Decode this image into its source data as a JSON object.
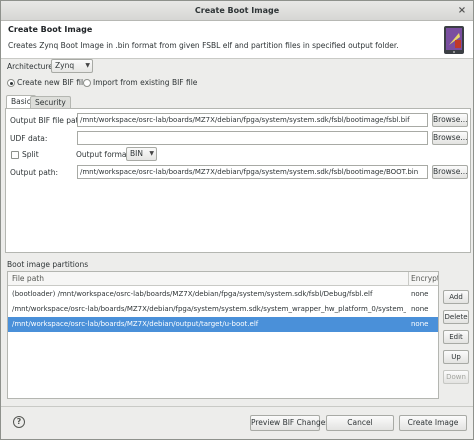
{
  "window": {
    "title": "Create Boot Image",
    "close_glyph": "×"
  },
  "banner": {
    "title": "Create Boot Image",
    "description": "Creates Zynq Boot Image in .bin format from given FSBL elf and partition files in specified output folder.",
    "icon": "boot-image-icon"
  },
  "architecture": {
    "label": "Architecture:",
    "value": "Zynq"
  },
  "mode": {
    "create_new_label": "Create new BIF file",
    "import_label": "Import from existing BIF file",
    "selected": "create_new"
  },
  "tabs": [
    {
      "label": "Basic",
      "active": true
    },
    {
      "label": "Security",
      "active": false
    }
  ],
  "basic": {
    "output_bif_label": "Output BIF file path:",
    "output_bif_value": "/mnt/workspace/osrc-lab/boards/MZ7X/debian/fpga/system/system.sdk/fsbl/bootimage/fsbl.bif",
    "udf_label": "UDF data:",
    "udf_value": "",
    "split_label": "Split",
    "split_checked": false,
    "output_format_label": "Output format:",
    "output_format_value": "BIN",
    "output_path_label": "Output path:",
    "output_path_value": "/mnt/workspace/osrc-lab/boards/MZ7X/debian/fpga/system/system.sdk/fsbl/bootimage/BOOT.bin",
    "browse_label": "Browse..."
  },
  "partitions": {
    "section_title": "Boot image partitions",
    "columns": [
      "File path",
      "Encrypted"
    ],
    "rows": [
      {
        "file_path": "(bootloader) /mnt/workspace/osrc-lab/boards/MZ7X/debian/fpga/system/system.sdk/fsbl/Debug/fsbl.elf",
        "encrypted": "none",
        "selected": false
      },
      {
        "file_path": "/mnt/workspace/osrc-lab/boards/MZ7X/debian/fpga/system/system.sdk/system_wrapper_hw_platform_0/system_wrapper.bit",
        "encrypted": "none",
        "selected": false
      },
      {
        "file_path": "/mnt/workspace/osrc-lab/boards/MZ7X/debian/output/target/u-boot.elf",
        "encrypted": "none",
        "selected": true
      }
    ],
    "buttons": {
      "add": "Add",
      "delete": "Delete",
      "edit": "Edit",
      "up": "Up",
      "down": "Down"
    }
  },
  "footer": {
    "help_glyph": "?",
    "preview_label": "Preview BIF Changes",
    "cancel_label": "Cancel",
    "create_label": "Create Image"
  },
  "colors": {
    "selection": "#4a90d9",
    "banner_bg": "#ffffff",
    "dialog_bg": "#ededeb"
  }
}
